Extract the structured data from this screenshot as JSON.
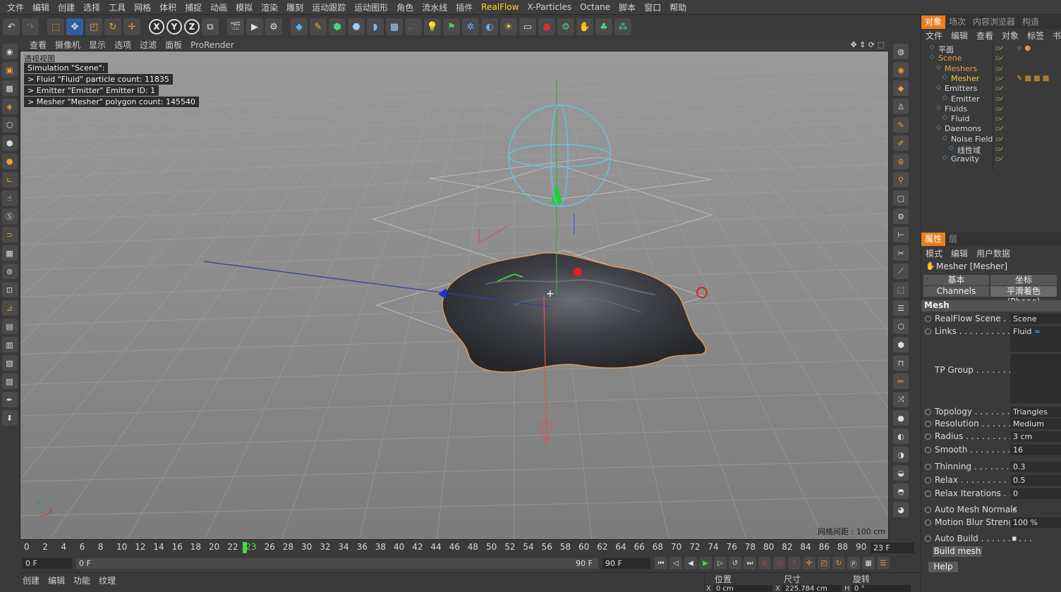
{
  "menu": [
    "文件",
    "编辑",
    "创建",
    "选择",
    "工具",
    "网格",
    "体积",
    "捕捉",
    "动画",
    "模拟",
    "渲染",
    "雕刻",
    "运动跟踪",
    "运动图形",
    "角色",
    "流水线",
    "插件",
    "RealFlow",
    "X-Particles",
    "Octane",
    "脚本",
    "窗口",
    "帮助"
  ],
  "toolbar": {
    "axis_x": "X",
    "axis_y": "Y",
    "axis_z": "Z"
  },
  "viewport": {
    "menu": [
      "查看",
      "摄像机",
      "显示",
      "选项",
      "过滤",
      "面板",
      "ProRender"
    ],
    "label": "透视视图",
    "info": [
      "Simulation \"Scene\":",
      "  > Fluid \"Fluid\" particle count: 11835",
      "  > Emitter \"Emitter\" Emitter ID: 1",
      "  > Mesher \"Mesher\" polygon count: 145540"
    ],
    "grid_spacing": "网格间距 : 100 cm",
    "axis_y": "Y",
    "axis_x": "X"
  },
  "object_panel": {
    "tabs": [
      "对象",
      "场次",
      "内容浏览器",
      "构造"
    ],
    "submenu": [
      "文件",
      "编辑",
      "查看",
      "对象",
      "标签",
      "书"
    ],
    "tree": [
      {
        "name": "平面",
        "depth": 0,
        "color": "#d8d8d8"
      },
      {
        "name": "Scene",
        "depth": 0,
        "color": "#e6a33a"
      },
      {
        "name": "Meshers",
        "depth": 1,
        "color": "#e6a33a"
      },
      {
        "name": "Mesher",
        "depth": 2,
        "color": "#ffcc33"
      },
      {
        "name": "Emitters",
        "depth": 1,
        "color": "#d8d8d8"
      },
      {
        "name": "Emitter",
        "depth": 2,
        "color": "#d8d8d8"
      },
      {
        "name": "Fluids",
        "depth": 1,
        "color": "#d8d8d8"
      },
      {
        "name": "Fluid",
        "depth": 2,
        "color": "#d8d8d8"
      },
      {
        "name": "Daemons",
        "depth": 1,
        "color": "#d8d8d8"
      },
      {
        "name": "Noise Field",
        "depth": 2,
        "color": "#d8d8d8"
      },
      {
        "name": "线性域",
        "depth": 3,
        "color": "#d8d8d8"
      },
      {
        "name": "Gravity",
        "depth": 2,
        "color": "#d8d8d8"
      }
    ]
  },
  "attributes": {
    "tabs": [
      "属性",
      "层"
    ],
    "submenu": [
      "模式",
      "编辑",
      "用户数据"
    ],
    "object_title": "Mesher [Mesher]",
    "btn_basic": "基本",
    "btn_coord": "坐标",
    "btn_channels": "Channels",
    "btn_phong": "平滑着色(Phong)",
    "section": "Mesh",
    "realflow_scene_label": "RealFlow Scene . . . .",
    "realflow_scene_value": "Scene",
    "links_label": "Links . . . . . . . . . . . . . .",
    "links_value": "Fluid",
    "tp_group_label": "TP Group . . . . . . . . . .",
    "rows": [
      {
        "label": "Topology . . . . . . . . . . . .",
        "value": "Triangles"
      },
      {
        "label": "Resolution . . . . . . . . . .",
        "value": "Medium"
      },
      {
        "label": "Radius . . . . . . . . . . . . . .",
        "value": "3 cm"
      },
      {
        "label": "Smooth . . . . . . . . . . . . .",
        "value": "16"
      },
      {
        "label": "Thinning . . . . . . . . . . . .",
        "value": "0.3"
      },
      {
        "label": "Relax . . . . . . . . . . . . . . .",
        "value": "0.5"
      },
      {
        "label": "Relax Iterations . . . . . . .",
        "value": "0"
      },
      {
        "label": "Auto Mesh Normals",
        "value": "✓"
      },
      {
        "label": "Motion Blur Strength",
        "value": "100 %"
      },
      {
        "label": "Auto Build . . . . . . . . . .",
        "value": "▪"
      }
    ],
    "build_mesh": "Build mesh",
    "help": "Help"
  },
  "timeline": {
    "ticks": [
      "0",
      "2",
      "4",
      "6",
      "8",
      "10",
      "12",
      "14",
      "16",
      "18",
      "20",
      "22",
      "23",
      "26",
      "28",
      "30",
      "32",
      "34",
      "36",
      "38",
      "40",
      "42",
      "44",
      "46",
      "48",
      "50",
      "52",
      "54",
      "56",
      "58",
      "60",
      "62",
      "64",
      "66",
      "68",
      "70",
      "72",
      "74",
      "76",
      "78",
      "80",
      "82",
      "84",
      "86",
      "88",
      "90"
    ],
    "current_frame": "23 F",
    "start_field": "0 F",
    "range_start": "0 F",
    "range_end": "90 F",
    "end_field": "90 F"
  },
  "bottom": {
    "menu": [
      "创建",
      "编辑",
      "功能",
      "纹理"
    ],
    "coord_headers": [
      "位置",
      "尺寸",
      "旋转"
    ],
    "pos_x": "0 cm",
    "size_x": "225.784 cm",
    "rot_h": "0 °",
    "x_label": "X",
    "x_label2": "X",
    "h_label": "H"
  }
}
